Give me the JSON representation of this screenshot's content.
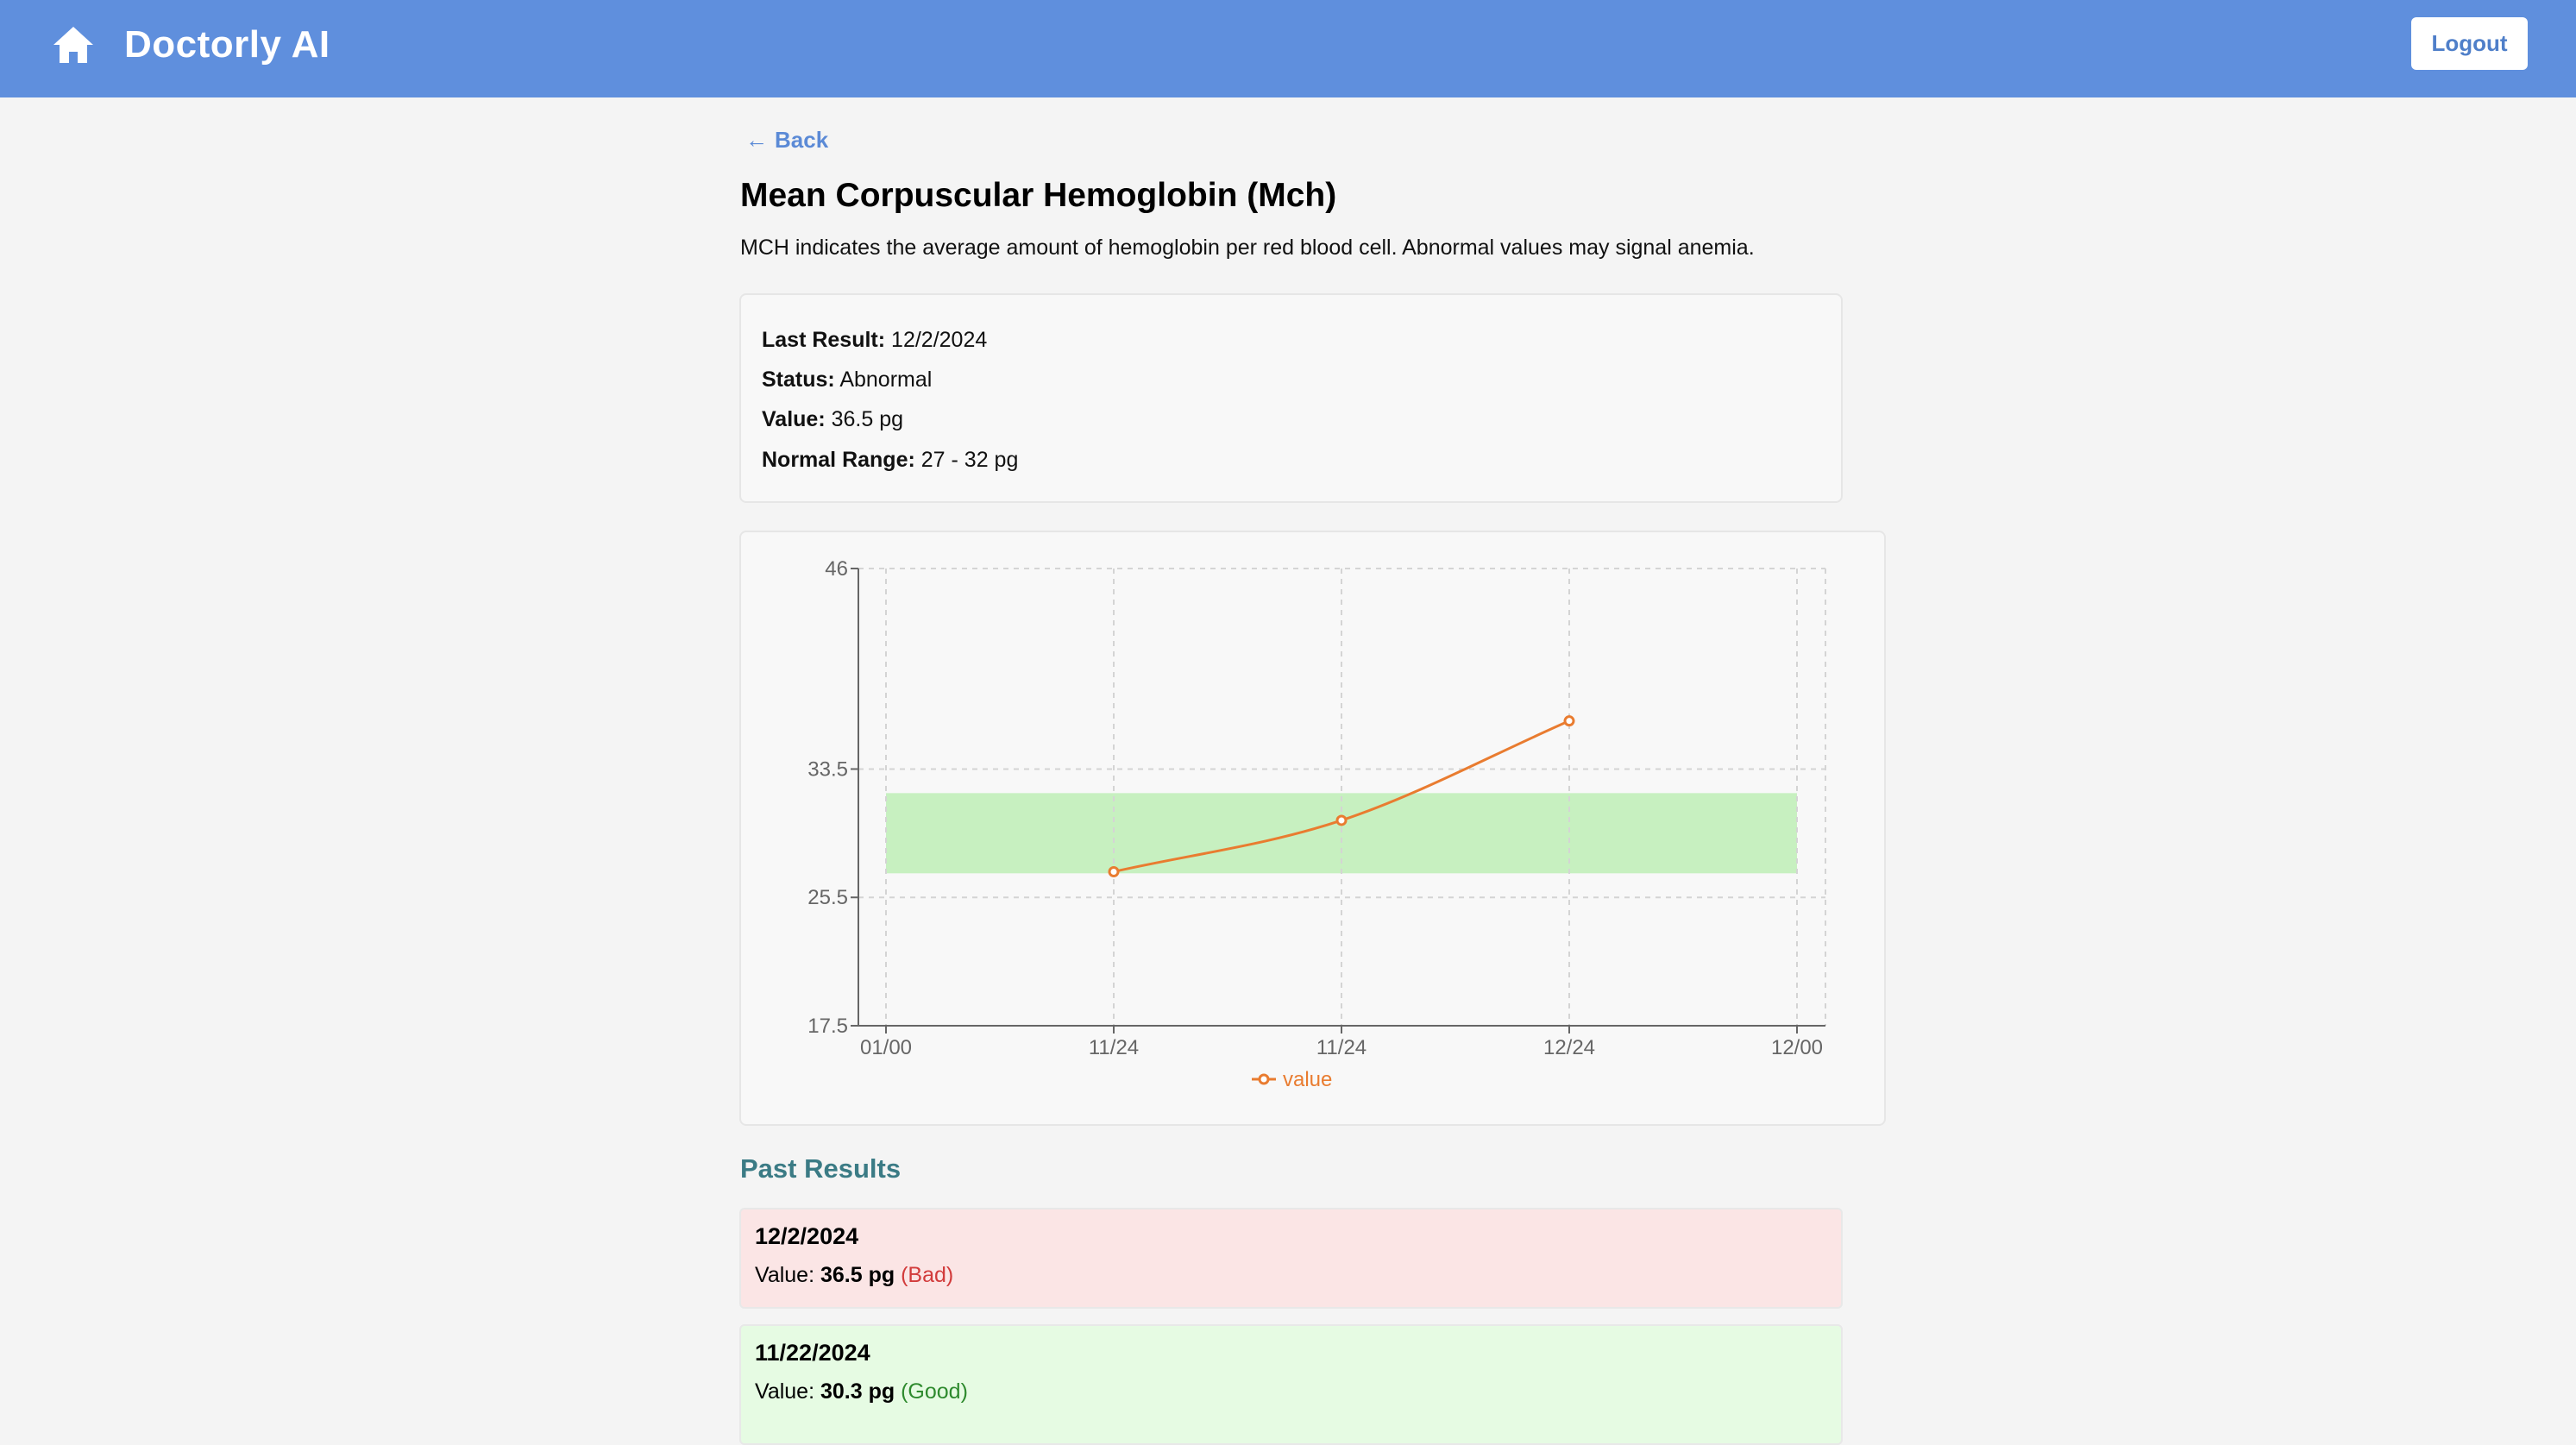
{
  "app": {
    "name": "Doctorly AI",
    "logout_label": "Logout",
    "colors": {
      "header": "#5f8fdd",
      "accent": "#5b8ad6"
    }
  },
  "nav": {
    "back_arrow": "←",
    "back_label": "Back"
  },
  "test": {
    "title": "Mean Corpuscular Hemoglobin (Mch)",
    "description": "MCH indicates the average amount of hemoglobin per red blood cell. Abnormal values may signal anemia."
  },
  "summary": {
    "last_result_label": "Last Result:",
    "last_result": "12/2/2024",
    "status_label": "Status:",
    "status": "Abnormal",
    "value_label": "Value:",
    "value": "36.5 pg",
    "range_label": "Normal Range:",
    "range": "27 - 32 pg"
  },
  "chart_data": {
    "type": "line",
    "x_ticks": [
      "01/00",
      "11/24",
      "11/24",
      "12/24",
      "12/00"
    ],
    "y_ticks": [
      "46",
      "33.5",
      "25.5",
      "17.5"
    ],
    "ylim": [
      17.5,
      46
    ],
    "grid": true,
    "series": [
      {
        "name": "value",
        "color": "#e97c30",
        "x_index": [
          1,
          2,
          3
        ],
        "values": [
          27.1,
          30.3,
          36.5
        ]
      }
    ],
    "reference_band": {
      "low": 27,
      "high": 32,
      "color": "#c7f0c0"
    },
    "legend": "bottom-center"
  },
  "past_results": {
    "title": "Past Results",
    "value_label": "Value:",
    "items": [
      {
        "date": "12/2/2024",
        "value": "36.5 pg",
        "status": "(Bad)",
        "kind": "bad"
      },
      {
        "date": "11/22/2024",
        "value": "30.3 pg",
        "status": "(Good)",
        "kind": "good"
      }
    ]
  },
  "icons": {
    "home": "home-icon"
  }
}
